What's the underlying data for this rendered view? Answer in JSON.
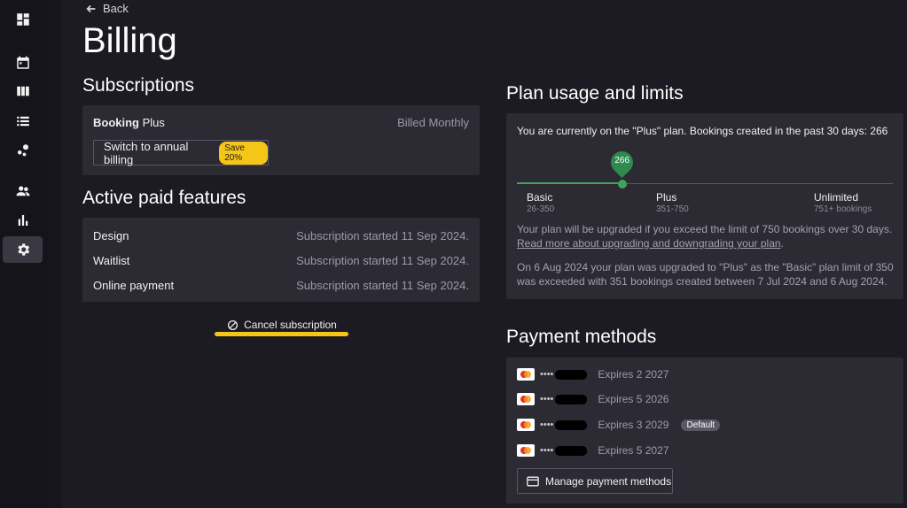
{
  "sidebar": {
    "icons": [
      "dashboard-icon",
      "calendar-icon",
      "columns-icon",
      "list-icon",
      "workflow-icon",
      "people-icon",
      "bar-chart-icon",
      "settings-icon"
    ],
    "active": "settings-icon"
  },
  "header": {
    "back_label": "Back",
    "page_title": "Billing"
  },
  "subscriptions": {
    "title": "Subscriptions",
    "plan_brand": "Booking",
    "plan_tier": "Plus",
    "billing_cycle": "Billed Monthly",
    "annual_button": "Switch to annual billing",
    "save_badge": "Save 20%"
  },
  "features": {
    "title": "Active paid features",
    "items": [
      {
        "name": "Design",
        "status": "Subscription started 11 Sep 2024."
      },
      {
        "name": "Waitlist",
        "status": "Subscription started 11 Sep 2024."
      },
      {
        "name": "Online payment",
        "status": "Subscription started 11 Sep 2024."
      }
    ],
    "cancel_label": "Cancel subscription"
  },
  "usage": {
    "title": "Plan usage and limits",
    "summary": "You are currently on the \"Plus\" plan. Bookings created in the past 30 days: 266",
    "current_value": "266",
    "current_fraction": 0.28,
    "tiers": [
      {
        "name": "Basic",
        "range": "26-350"
      },
      {
        "name": "Plus",
        "range": "351-750"
      },
      {
        "name": "Unlimited",
        "range": "751+ bookings"
      }
    ],
    "note_line": "Your plan will be upgraded if you exceed the limit of 750 bookings over 30 days.",
    "note_link": "Read more about upgrading and downgrading your plan",
    "note_link_suffix": ".",
    "history": "On 6 Aug 2024 your plan was upgraded to \"Plus\" as the \"Basic\" plan limit of 350 was exceeded with 351 bookings created between 7 Jul 2024 and 6 Aug 2024."
  },
  "payment": {
    "title": "Payment methods",
    "masked_prefix": "••••",
    "cards": [
      {
        "expiry": "Expires 2 2027",
        "default": false
      },
      {
        "expiry": "Expires 5 2026",
        "default": false
      },
      {
        "expiry": "Expires 3 2029",
        "default": true
      },
      {
        "expiry": "Expires 5 2027",
        "default": false
      }
    ],
    "default_label": "Default",
    "manage_label": "Manage payment methods"
  },
  "colors": {
    "accent_yellow": "#f5c518",
    "progress_green": "#3fa35c",
    "background": "#1c1a22",
    "card": "#2c2a33"
  }
}
